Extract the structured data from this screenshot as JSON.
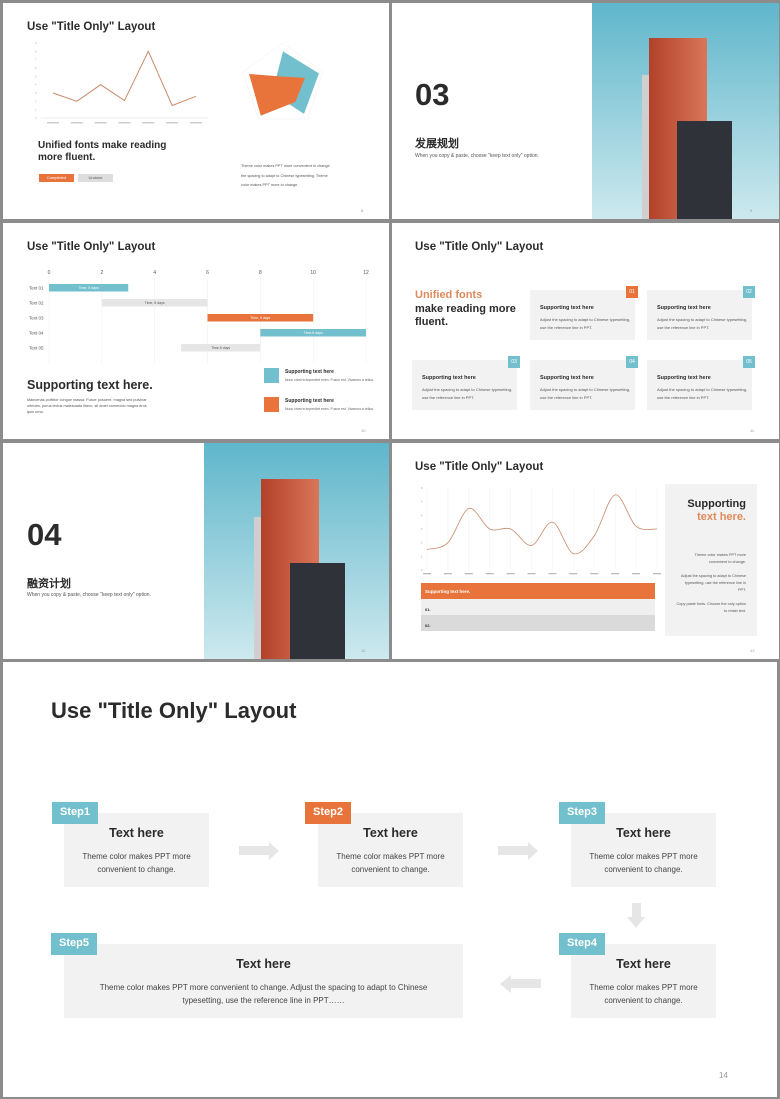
{
  "colors": {
    "orange": "#e8743b",
    "teal": "#72c0cd",
    "gray": "#e6e6e6"
  },
  "slide1": {
    "title": "Use \"Title Only\" Layout",
    "heading": "Unified fonts make reading more fluent.",
    "completed": "Completed",
    "undone": "Undone",
    "body": [
      "Theme color makes PPT more convenient to change.",
      "the spacing to adapt to Chinese typesetting. Theme",
      "color makes PPT more to change."
    ],
    "page": "8",
    "line_chart": {
      "type": "line",
      "ylim": [
        0,
        9
      ],
      "values": [
        3,
        2,
        4,
        2.1,
        8,
        1.5,
        2.6
      ]
    },
    "radar_chart": {
      "type": "radar",
      "axes": 5,
      "series": [
        {
          "color": "#72c0cd",
          "values": [
            0.8,
            0.9,
            0.85,
            0.3,
            0.2
          ]
        },
        {
          "color": "#e8743b",
          "values": [
            0.2,
            0.55,
            0.5,
            0.9,
            0.85
          ]
        }
      ]
    }
  },
  "slide2": {
    "number": "03",
    "heading": "发展规划",
    "sub": "When you copy & paste, choose \"keep text only\" option.",
    "page": "9"
  },
  "slide3": {
    "title": "Use \"Title Only\" Layout",
    "heading": "Supporting text here.",
    "body": "Maecenas porttitor congue massa. Fusce posuere, magna sed pulvinar ultricies, purus lectus malesuada libero, sit amet commodo magna eros quis urna.",
    "items": [
      {
        "title": "Supporting text here",
        "text": "Nunc viverra imperdiet enim. Fusce est. Vivamus a tellus.",
        "icon": "building-icon",
        "color": "#72c0cd"
      },
      {
        "title": "Supporting text here",
        "text": "Nunc viverra imperdiet enim. Fusce est. Vivamus a tellus.",
        "icon": "document-icon",
        "color": "#e8743b"
      }
    ],
    "page": "10",
    "chart_data": {
      "type": "gantt",
      "ticks": [
        "0",
        "2",
        "4",
        "6",
        "8",
        "10",
        "12"
      ],
      "xlim": [
        0,
        12
      ],
      "rows": [
        {
          "label": "Text 01",
          "start": 0,
          "end": 3,
          "text": "Time, 5 days",
          "color": "#72c0cd"
        },
        {
          "label": "Text 02",
          "start": 2,
          "end": 6,
          "text": "Time, 5 days",
          "color": "#e6e6e6"
        },
        {
          "label": "Text 03",
          "start": 6,
          "end": 10,
          "text": "Time, 5 days",
          "color": "#e8743b"
        },
        {
          "label": "Text 04",
          "start": 8,
          "end": 12,
          "text": "Time,5 days",
          "color": "#72c0cd"
        },
        {
          "label": "Text 05",
          "start": 5,
          "end": 8,
          "text": "Time,5 days",
          "color": "#e6e6e6"
        }
      ]
    }
  },
  "slide4": {
    "title": "Use \"Title Only\" Layout",
    "heading_orange": "Unified fonts",
    "heading_rest": "make reading more fluent.",
    "cards": [
      {
        "num": "01",
        "title": "Supporting text here",
        "text": "Adjust the spacing to adapt to Chinese typesetting, use the reference line in PPT."
      },
      {
        "num": "02",
        "title": "Supporting text here",
        "text": "Adjust the spacing to adapt to Chinese typesetting, use the reference line in PPT."
      },
      {
        "num": "03",
        "title": "Supporting text here",
        "text": "Adjust the spacing to adapt to Chinese typesetting, use the reference line in PPT."
      },
      {
        "num": "04",
        "title": "Supporting text here",
        "text": "Adjust the spacing to adapt to Chinese typesetting, use the reference line in PPT."
      },
      {
        "num": "05",
        "title": "Supporting text here",
        "text": "Adjust the spacing to adapt to Chinese typesetting, use the reference line in PPT."
      }
    ],
    "page": "11"
  },
  "slide5": {
    "number": "04",
    "heading": "融资计划",
    "sub": "When you copy & paste, choose \"keep text only\" option.",
    "page": "12"
  },
  "slide6": {
    "title": "Use \"Title Only\" Layout",
    "table_header": "Supporting text here.",
    "rows": [
      "01.",
      "02."
    ],
    "panel_dark": "Supporting",
    "panel_orange": "text here.",
    "panel_texts": [
      "Theme color makes PPT more convenient to change.",
      "Adjust the spacing to adapt to Chinese typesetting, use the reference line in PPT.",
      "Copy paste fonts. Choose the only option to retain text."
    ],
    "page": "13",
    "chart_data": {
      "type": "line",
      "smooth": true,
      "ylim": [
        0,
        6
      ],
      "yticks": [
        0,
        1,
        2,
        3,
        4,
        5,
        6
      ],
      "values": [
        1.5,
        2,
        4.5,
        3,
        3,
        1.8,
        3.5,
        1.2,
        2.5,
        5.5,
        3.2,
        3
      ]
    }
  },
  "slide7": {
    "title": "Use \"Title Only\" Layout",
    "steps": [
      {
        "label": "Step1",
        "title": "Text here",
        "text": "Theme color makes PPT more convenient to change."
      },
      {
        "label": "Step2",
        "title": "Text here",
        "text": "Theme color makes PPT more convenient to change."
      },
      {
        "label": "Step3",
        "title": "Text here",
        "text": "Theme color makes PPT more convenient to change."
      },
      {
        "label": "Step4",
        "title": "Text here",
        "text": "Theme color makes PPT more convenient to change."
      },
      {
        "label": "Step5",
        "title": "Text here",
        "text": "Theme color makes PPT more convenient to change. Adjust the spacing to adapt to Chinese typesetting, use the reference line in PPT……"
      }
    ],
    "page": "14"
  }
}
